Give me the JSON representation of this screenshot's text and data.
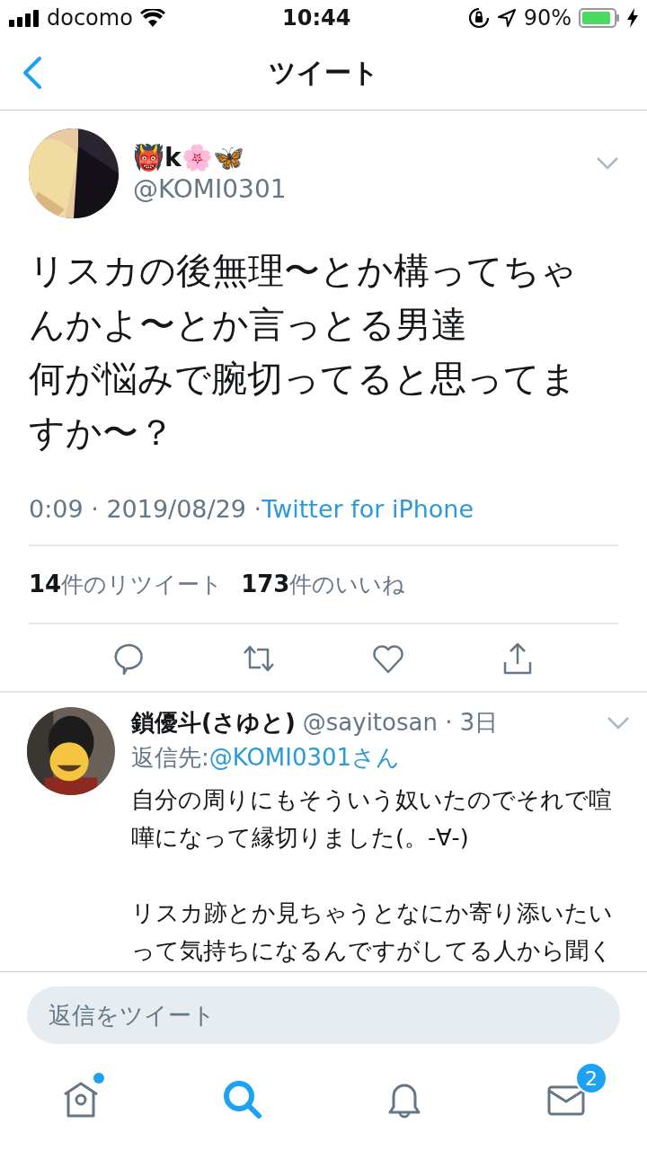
{
  "status_bar": {
    "carrier": "docomo",
    "time": "10:44",
    "battery": "90%"
  },
  "nav": {
    "title": "ツイート"
  },
  "tweet": {
    "display_name": "👹k🌸🦋",
    "handle": "@KOMI0301",
    "text": [
      "リスカの後無理〜とか構ってちゃんかよ〜とか言っとる男達",
      "何が悩みで腕切ってると思ってますか〜？"
    ],
    "time": "0:09 · 2019/08/29 · ",
    "source": "Twitter for iPhone",
    "retweets": "**14**件のリツイート",
    "likes": "**173**件のいいね"
  },
  "reply": {
    "display_name": "鎖優斗(さゆと)",
    "handle": "@sayitosan · 3日",
    "reply_to_label": "返信先: ",
    "reply_to": "@KOMI0301さん",
    "text": [
      "自分の周りにもそういう奴いたのでそれで喧嘩になって縁切りました(。-∀-)",
      "リスカ跡とか見ちゃうとなにか寄り添いたいって気持ちになるんですがしてる人から聞く"
    ]
  },
  "composer": {
    "placeholder": "返信をツイート"
  },
  "tabs": [
    {
      "kind": "home",
      "selected": false,
      "unread": true
    },
    {
      "kind": "search",
      "selected": true,
      "unread": false
    },
    {
      "kind": "notifications",
      "selected": false,
      "unread": false
    },
    {
      "kind": "messages",
      "selected": false,
      "unread": false,
      "badge": "2"
    }
  ]
}
